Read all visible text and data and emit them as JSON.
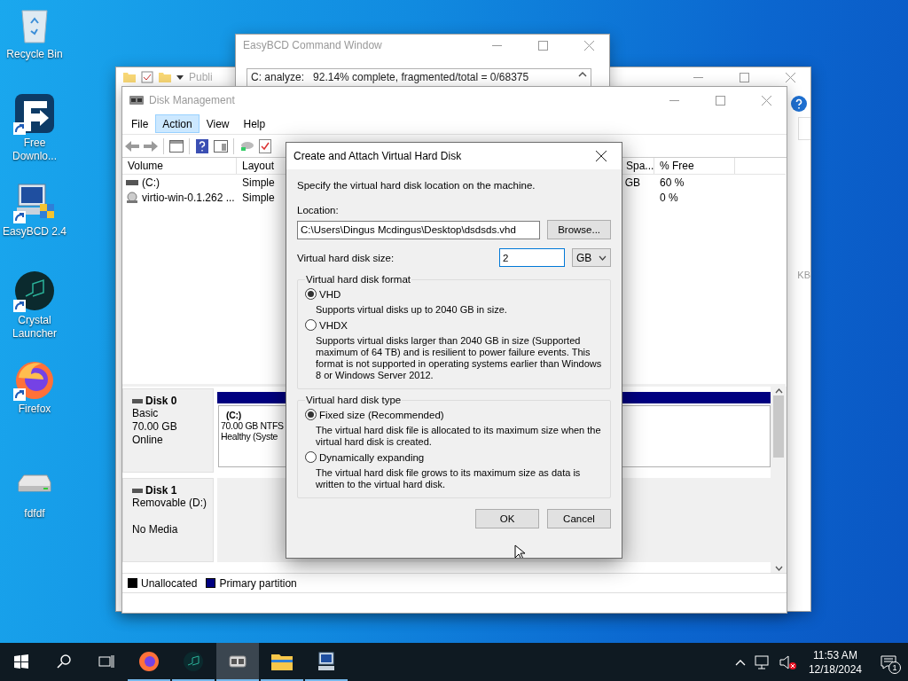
{
  "desktop_icons": [
    {
      "label": "Recycle Bin",
      "kind": "recycle",
      "shortcut": false
    },
    {
      "label": "Free Downlo...",
      "kind": "download",
      "shortcut": true
    },
    {
      "label": "EasyBCD 2.4",
      "kind": "easybcd",
      "shortcut": true
    },
    {
      "label": "Crystal Launcher",
      "kind": "crystal",
      "shortcut": true
    },
    {
      "label": "Firefox",
      "kind": "firefox",
      "shortcut": true
    },
    {
      "label": "fdfdf",
      "kind": "drive",
      "shortcut": false
    }
  ],
  "explorer_window": {
    "toolbar_text": "Publi",
    "side_text": "KB"
  },
  "easybcd_window": {
    "title": "EasyBCD Command Window",
    "output_line": "C: analyze:   92.14% complete, fragmented/total = 0/68375"
  },
  "disk_management": {
    "title": "Disk Management",
    "menu": [
      {
        "label": "File",
        "selected": false
      },
      {
        "label": "Action",
        "selected": true
      },
      {
        "label": "View",
        "selected": false
      },
      {
        "label": "Help",
        "selected": false
      }
    ],
    "columns": [
      "Volume",
      "Layout",
      "Spa...",
      "% Free"
    ],
    "volumes": [
      {
        "kind": "drive",
        "volume": "(C:)",
        "layout": "Simple",
        "free_space": "GB",
        "percent_free": "60 %"
      },
      {
        "kind": "disc",
        "volume": "virtio-win-0.1.262 ...",
        "layout": "Simple",
        "percent_free": "0 %"
      }
    ],
    "disks": [
      {
        "name": "Disk 0",
        "type": "Basic",
        "size": "70.00 GB",
        "status": "Online",
        "partition": {
          "name": "(C:)",
          "detail": "70.00 GB NTFS",
          "health": "Healthy (Syste"
        }
      },
      {
        "name": "Disk 1",
        "type": "Removable (D:)",
        "status": "No Media"
      }
    ],
    "legend": [
      {
        "label": "Unallocated",
        "color": "#000000"
      },
      {
        "label": "Primary partition",
        "color": "#000080"
      }
    ]
  },
  "dialog": {
    "title": "Create and Attach Virtual Hard Disk",
    "intro": "Specify the virtual hard disk location on the machine.",
    "location_label": "Location:",
    "location_value": "C:\\Users\\Dingus Mcdingus\\Desktop\\dsdsds.vhd",
    "browse_button": "Browse...",
    "size_label": "Virtual hard disk size:",
    "size_value": "2",
    "size_unit": "GB",
    "groups": [
      {
        "title": "Virtual hard disk format",
        "options": [
          {
            "label": "VHD",
            "selected": true,
            "description": "Supports virtual disks up to 2040 GB in size."
          },
          {
            "label": "VHDX",
            "selected": false,
            "description": "Supports virtual disks larger than 2040 GB in size (Supported maximum of 64 TB) and is resilient to power failure events. This format is not supported in operating systems earlier than Windows 8 or Windows Server 2012."
          }
        ]
      },
      {
        "title": "Virtual hard disk type",
        "options": [
          {
            "label": "Fixed size (Recommended)",
            "selected": true,
            "description": "The virtual hard disk file is allocated to its maximum size when the virtual hard disk is created."
          },
          {
            "label": "Dynamically expanding",
            "selected": false,
            "description": "The virtual hard disk file grows to its maximum size as data is written to the virtual hard disk."
          }
        ]
      }
    ],
    "buttons": [
      "OK",
      "Cancel"
    ]
  },
  "taskbar": {
    "apps": [
      {
        "kind": "firefox",
        "running": true,
        "selected": false
      },
      {
        "kind": "crystal",
        "running": true,
        "selected": false
      },
      {
        "kind": "diskmgmt",
        "running": true,
        "selected": true
      },
      {
        "kind": "explorer",
        "running": true,
        "selected": false
      },
      {
        "kind": "easybcd",
        "running": true,
        "selected": false
      }
    ],
    "time": "11:53 AM",
    "date": "12/18/2024",
    "notifications": "1"
  }
}
